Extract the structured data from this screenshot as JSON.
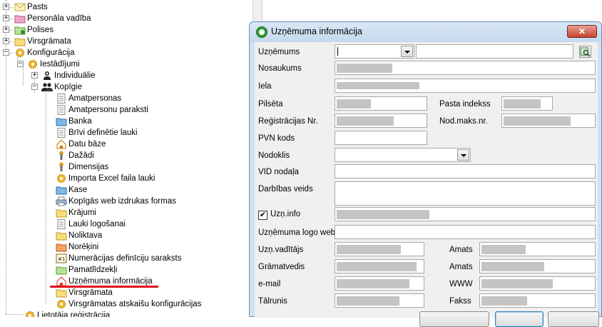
{
  "tree": {
    "items": [
      {
        "label": "Pasts",
        "icon": "envelope-icon"
      },
      {
        "label": "Personāla vadība",
        "icon": "pink-folder-icon"
      },
      {
        "label": "Polises",
        "icon": "green-folder-icon"
      },
      {
        "label": "Virsgrāmata",
        "icon": "yellow-folder-icon"
      },
      {
        "label": "Konfigurācija",
        "icon": "gear-icon"
      },
      {
        "label": "Iestādījumi",
        "icon": "gear-icon"
      },
      {
        "label": "Individuālie",
        "icon": "user-icon"
      },
      {
        "label": "Kopīgie",
        "icon": "users-icon"
      },
      {
        "label": "Amatpersonas",
        "icon": "document-icon"
      },
      {
        "label": "Amatpersonu paraksti",
        "icon": "document-icon"
      },
      {
        "label": "Banka",
        "icon": "blue-folder-icon"
      },
      {
        "label": "Brīvi definētie lauki",
        "icon": "document-icon"
      },
      {
        "label": "Datu bāze",
        "icon": "house-icon"
      },
      {
        "label": "Dažādi",
        "icon": "wrench-icon"
      },
      {
        "label": "Dimensijas",
        "icon": "wrench-icon"
      },
      {
        "label": "Importa Excel faila lauki",
        "icon": "gear-icon"
      },
      {
        "label": "Kase",
        "icon": "blue-folder-icon"
      },
      {
        "label": "Kopīgās web izdrukas formas",
        "icon": "printer-icon"
      },
      {
        "label": "Krājumi",
        "icon": "yellow-folder-icon"
      },
      {
        "label": "Lauki logošanai",
        "icon": "document-icon"
      },
      {
        "label": "Noliktava",
        "icon": "yellow-folder-icon"
      },
      {
        "label": "Norēķini",
        "icon": "orange-folder-icon"
      },
      {
        "label": "Numerācijas definīciju saraksts",
        "icon": "number-list-icon"
      },
      {
        "label": "Pamatlīdzekļi",
        "icon": "green-folder-icon"
      },
      {
        "label": "Uzņēmuma informācija",
        "icon": "house-icon"
      },
      {
        "label": "Virsgrāmata",
        "icon": "yellow-folder-icon"
      },
      {
        "label": "Virsgrāmatas atskaišu konfigurācijas",
        "icon": "gear-icon"
      },
      {
        "label": "Lietotāja reģistrācija",
        "icon": "gear-icon"
      }
    ]
  },
  "dialog": {
    "title": "Uzņēmuma informācija",
    "close_label": "✕",
    "labels": {
      "uznemums": "Uzņēmums",
      "nosaukums": "Nosaukums",
      "iela": "Iela",
      "pilseta": "Pilsēta",
      "pasta_indekss": "Pasta indekss",
      "reg_nr": "Reģistrācijas Nr.",
      "nod_maks_nr": "Nod.maks.nr.",
      "pvn_kods": "PVN kods",
      "nodoklis": "Nodoklis",
      "vid_nodala": "VID nodaļa",
      "darbibas_veids": "Darbības veids",
      "uzn_info": "Uzņ.info",
      "logo_web": "Uzņēmuma logo webā",
      "uzn_vaditajs": "Uzņ.vadītājs",
      "amats1": "Amats",
      "gramatvedis": "Grāmatvedis",
      "amats2": "Amats",
      "email": "e-mail",
      "www": "WWW",
      "talrunis": "Tālrunis",
      "fakss": "Fakss"
    },
    "uzn_info_checked": "✔"
  },
  "colors": {
    "highlight_underline": "#e0101a",
    "dialog_frame": "#cfe1f3",
    "redacted": "#c4c4c4"
  }
}
